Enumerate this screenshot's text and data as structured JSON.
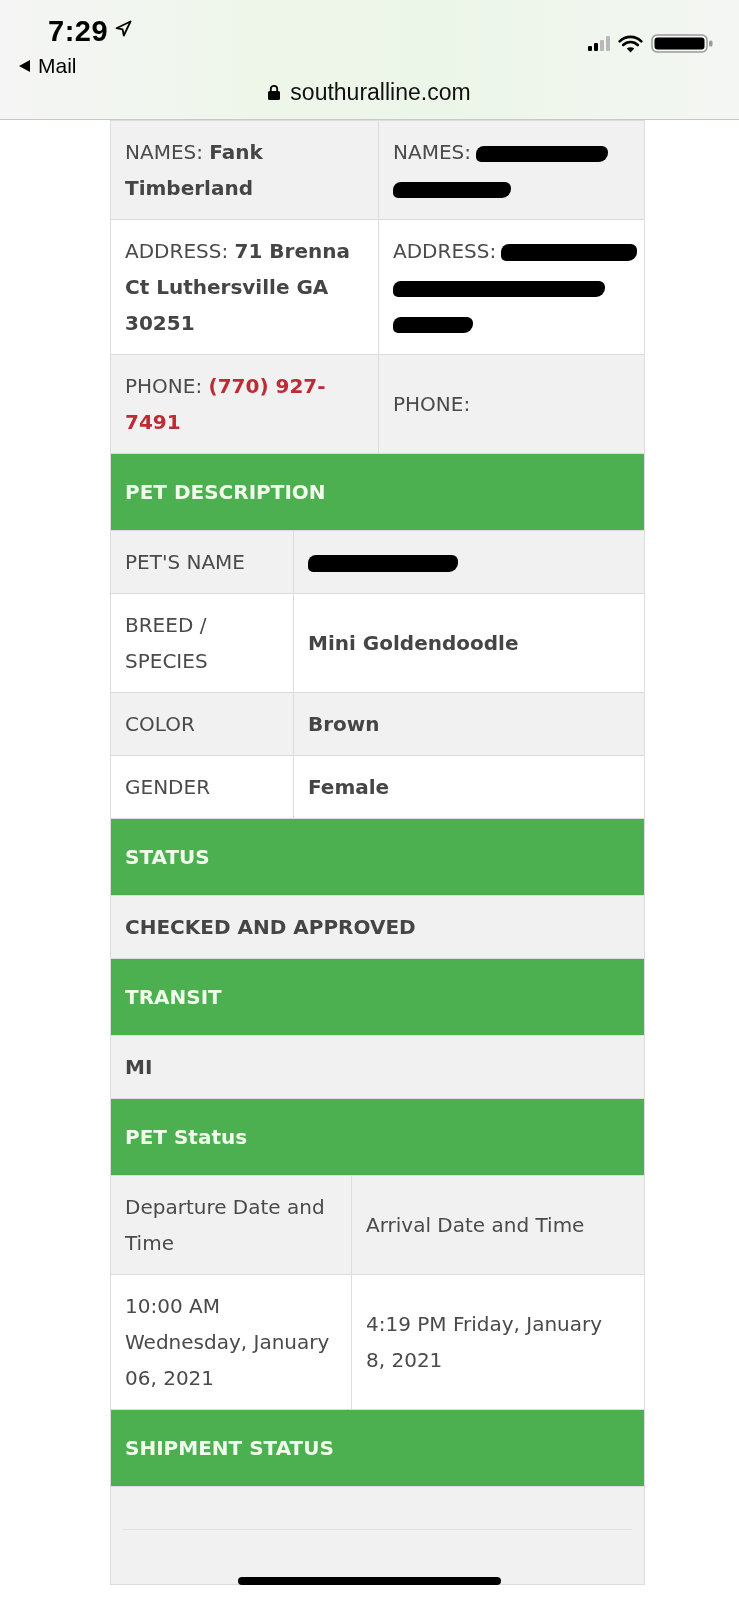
{
  "status_bar": {
    "time": "7:29",
    "back_label": "Mail"
  },
  "address_bar": {
    "url": "southuralline.com"
  },
  "sections": [
    {
      "kind": "contacts",
      "rows": [
        {
          "cells": [
            {
              "kind": "name",
              "label": "NAMES:",
              "value": "Fank Timberland",
              "redacted": false
            },
            {
              "kind": "name",
              "label": "NAMES:",
              "redacted": true
            }
          ]
        },
        {
          "cells": [
            {
              "kind": "address",
              "label": "ADDRESS:",
              "value": "71 Brenna Ct Luthersville GA 30251",
              "redacted": false
            },
            {
              "kind": "address",
              "label": "ADDRESS:",
              "redacted": true
            }
          ]
        },
        {
          "cells": [
            {
              "kind": "phone",
              "label": "PHONE:",
              "value": "(770) 927-7491",
              "redacted": false
            },
            {
              "kind": "phone",
              "label": "PHONE:",
              "redacted": false
            }
          ]
        }
      ]
    },
    {
      "kind": "details",
      "title": "PET DESCRIPTION",
      "rows": [
        {
          "label": "PET'S NAME",
          "redacted": true
        },
        {
          "label": "BREED / SPECIES",
          "value": "Mini Goldendoodle",
          "redacted": false
        },
        {
          "label": "COLOR",
          "value": "Brown",
          "redacted": false
        },
        {
          "label": "GENDER",
          "value": "Female",
          "redacted": false
        }
      ]
    },
    {
      "kind": "value",
      "title": "STATUS",
      "value": "CHECKED AND APPROVED"
    },
    {
      "kind": "value",
      "title": "TRANSIT",
      "value": "MI"
    },
    {
      "kind": "grid",
      "title": "PET Status",
      "columns": [
        "Departure Date and Time",
        "Arrival Date and Time"
      ],
      "rows": [
        {
          "cells": [
            {
              "lines": [
                "10:00 AM",
                "Wednesday, January 06, 2021"
              ]
            },
            {
              "lines": [
                "4:19 PM Friday, January 8, 2021"
              ]
            }
          ]
        }
      ]
    },
    {
      "kind": "empty",
      "title": "SHIPMENT STATUS"
    }
  ]
}
